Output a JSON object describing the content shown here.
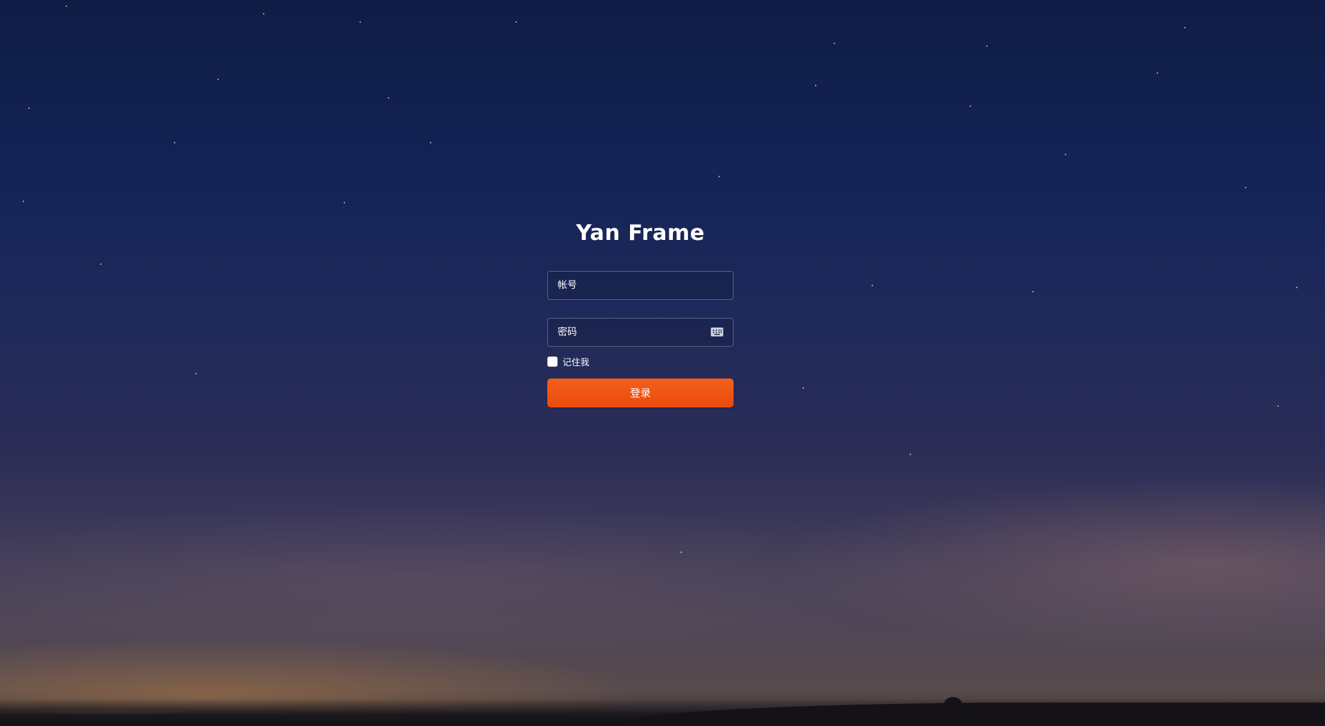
{
  "app": {
    "title": "Yan Frame"
  },
  "form": {
    "account_placeholder": "帐号",
    "password_placeholder": "密码",
    "remember_label": "记住我",
    "remember_checked": false,
    "login_label": "登录"
  },
  "icons": {
    "password_field_icon": "keyboard-icon"
  },
  "colors": {
    "login_button": "#ee5210",
    "sky_top": "#0f1c45",
    "text": "#ffffff"
  }
}
